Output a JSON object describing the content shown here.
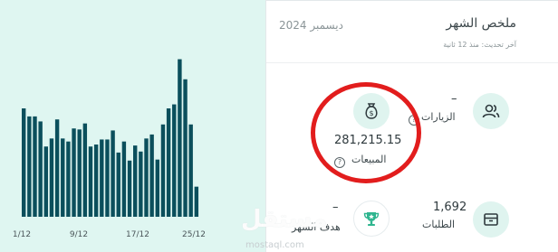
{
  "summary": {
    "title": "ملخص الشهر",
    "month": "ديسمبر 2024",
    "updated": "آخر تحديث: منذ 12 ثانية",
    "visits": {
      "value": "–",
      "label": "الزيارات",
      "icon": "users-icon"
    },
    "sales": {
      "value": "281,215.15",
      "label": "المبيعات",
      "icon": "money-bag-icon"
    },
    "orders": {
      "value": "1,692",
      "label": "الطلبات",
      "icon": "box-icon"
    },
    "goal": {
      "value": "–",
      "label": "هدف الشهر",
      "icon": "trophy-icon"
    }
  },
  "watermark": {
    "text": "مستقل",
    "sub": "mostaql.com"
  },
  "chart_data": {
    "type": "bar",
    "categories": [
      "1/12",
      "2/12",
      "3/12",
      "4/12",
      "5/12",
      "6/12",
      "7/12",
      "8/12",
      "9/12",
      "10/12",
      "11/12",
      "12/12",
      "13/12",
      "14/12",
      "15/12",
      "16/12",
      "17/12",
      "18/12",
      "19/12",
      "20/12",
      "21/12",
      "22/12",
      "23/12",
      "24/12",
      "25/12",
      "26/12",
      "27/12",
      "28/12",
      "29/12",
      "30/12",
      "31/12"
    ],
    "x_tick_labels": [
      "1/12",
      "9/12",
      "17/12",
      "25/12"
    ],
    "values": [
      108,
      100,
      100,
      95,
      70,
      78,
      97,
      78,
      75,
      88,
      87,
      93,
      70,
      72,
      77,
      77,
      86,
      64,
      75,
      56,
      71,
      65,
      78,
      82,
      57,
      92,
      108,
      112,
      157,
      137,
      92
    ],
    "extra_bar_value": 30,
    "ylim": [
      0,
      180
    ],
    "grid": false,
    "colors": {
      "bar": "#0b4f5c",
      "background": "#dff6f1"
    }
  }
}
